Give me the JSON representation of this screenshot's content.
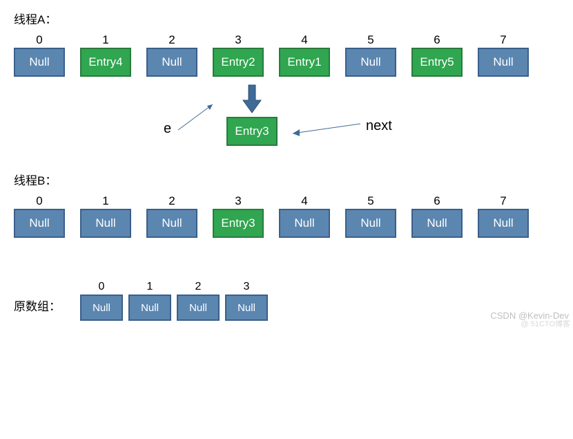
{
  "threadA": {
    "label": "线程A：",
    "cells": [
      {
        "index": "0",
        "value": "Null",
        "variant": "blue"
      },
      {
        "index": "1",
        "value": "Entry4",
        "variant": "green"
      },
      {
        "index": "2",
        "value": "Null",
        "variant": "blue"
      },
      {
        "index": "3",
        "value": "Entry2",
        "variant": "green"
      },
      {
        "index": "4",
        "value": "Entry1",
        "variant": "green"
      },
      {
        "index": "5",
        "value": "Null",
        "variant": "blue"
      },
      {
        "index": "6",
        "value": "Entry5",
        "variant": "green"
      },
      {
        "index": "7",
        "value": "Null",
        "variant": "blue"
      }
    ],
    "hanging": {
      "value": "Entry3"
    },
    "pointer_e": "e",
    "pointer_next": "next"
  },
  "threadB": {
    "label": "线程B：",
    "cells": [
      {
        "index": "0",
        "value": "Null",
        "variant": "blue"
      },
      {
        "index": "1",
        "value": "Null",
        "variant": "blue"
      },
      {
        "index": "2",
        "value": "Null",
        "variant": "blue"
      },
      {
        "index": "3",
        "value": "Entry3",
        "variant": "green"
      },
      {
        "index": "4",
        "value": "Null",
        "variant": "blue"
      },
      {
        "index": "5",
        "value": "Null",
        "variant": "blue"
      },
      {
        "index": "6",
        "value": "Null",
        "variant": "blue"
      },
      {
        "index": "7",
        "value": "Null",
        "variant": "blue"
      }
    ]
  },
  "origin": {
    "label": "原数组：",
    "cells": [
      {
        "index": "0",
        "value": "Null"
      },
      {
        "index": "1",
        "value": "Null"
      },
      {
        "index": "2",
        "value": "Null"
      },
      {
        "index": "3",
        "value": "Null"
      }
    ]
  },
  "watermarks": {
    "csdn": "CSDN @Kevin-Dev",
    "blog": "@ 51CTO博客"
  }
}
